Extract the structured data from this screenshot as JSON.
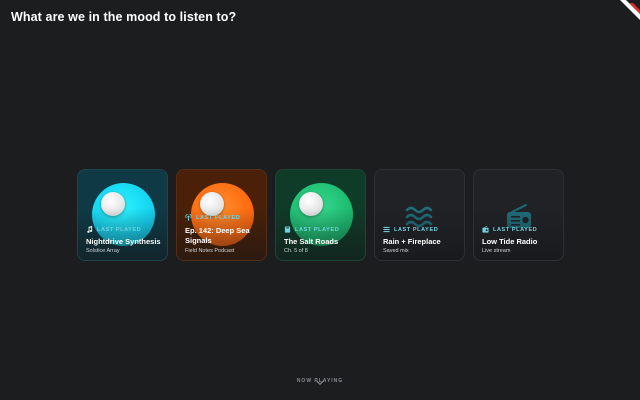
{
  "header": {
    "title": "What are we in the mood to listen to?"
  },
  "cards": [
    {
      "badge": "LAST PLAYED",
      "badge_icon": "music-note-icon",
      "title": "Nightdrive Synthesis",
      "subtitle": "Solstice Array"
    },
    {
      "badge": "LAST PLAYED",
      "badge_icon": "podcast-icon",
      "title": "Ep. 142: Deep Sea Signals",
      "subtitle": "Field Notes Podcast"
    },
    {
      "badge": "LAST PLAYED",
      "badge_icon": "book-icon",
      "title": "The Salt Roads",
      "subtitle": "Ch. 5 of 8"
    },
    {
      "badge": "LAST PLAYED",
      "badge_icon": "playlist-icon",
      "art_icon": "waves-icon",
      "title": "Rain + Fireplace",
      "subtitle": "Saved mix"
    },
    {
      "badge": "LAST PLAYED",
      "badge_icon": "radio-icon",
      "art_icon": "radio-icon",
      "title": "Low Tide Radio",
      "subtitle": "Live stream"
    }
  ],
  "footer": {
    "now_playing_label": "NOW PLAYING",
    "toggle_icon": "chevron-down-icon"
  },
  "colors": {
    "background": "#1c1d1f",
    "accent": "#6fd3e0",
    "card1": "#16d6f2",
    "card2": "#ff6d12",
    "card3": "#1fbf74"
  }
}
